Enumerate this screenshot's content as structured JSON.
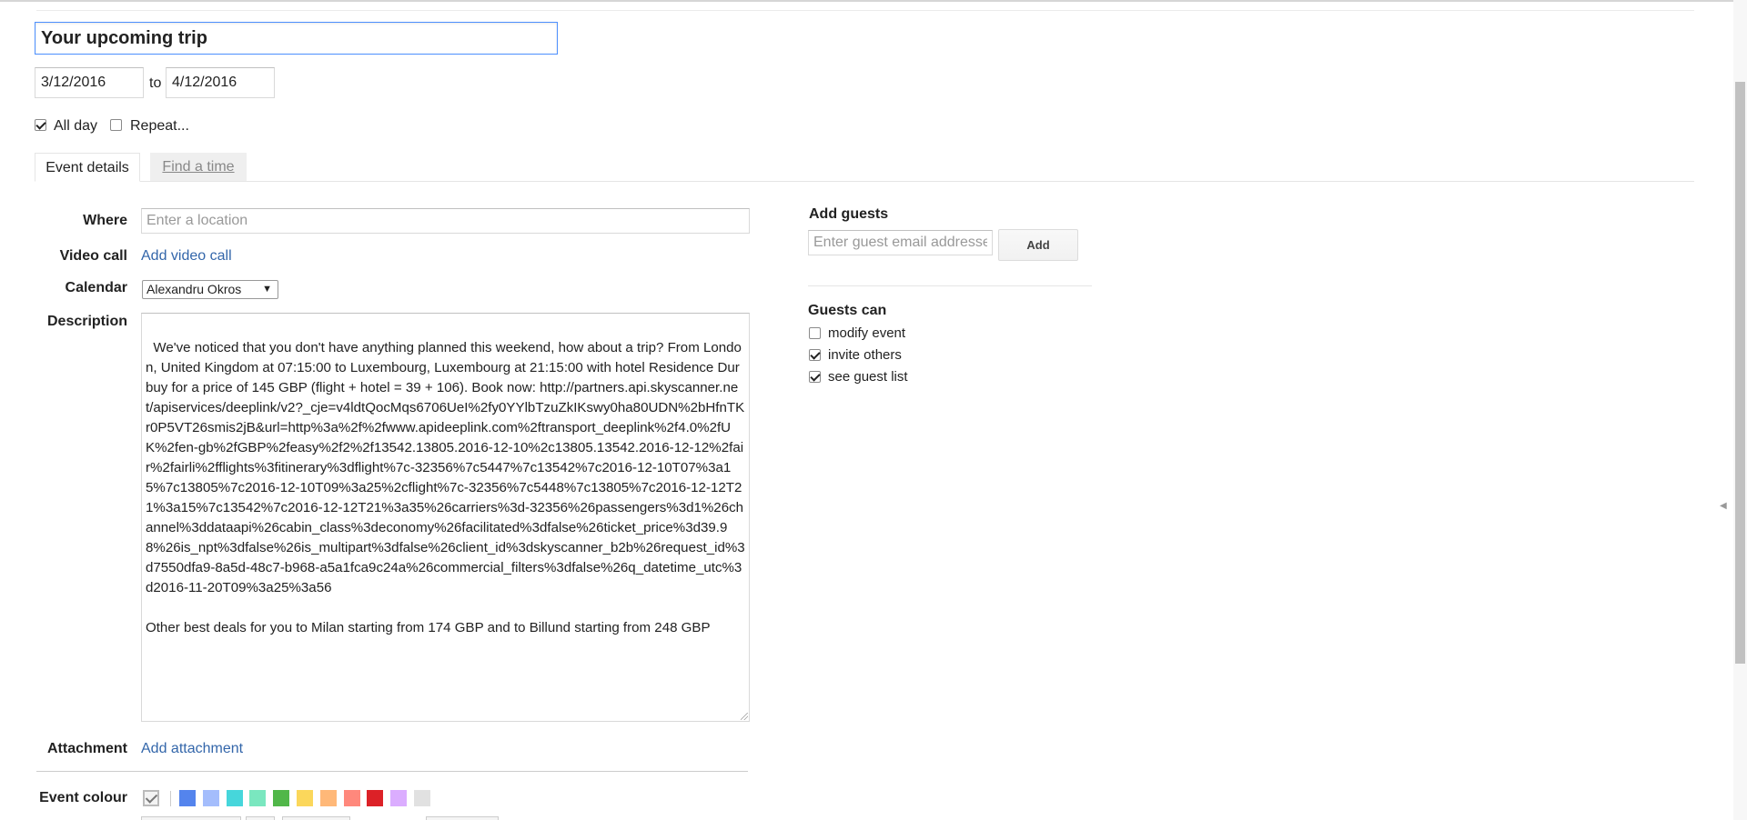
{
  "event": {
    "title": "Your upcoming trip",
    "start_date": "3/12/2016",
    "to_label": "to",
    "end_date": "4/12/2016",
    "all_day_label": "All day",
    "all_day_checked": true,
    "repeat_label": "Repeat...",
    "repeat_checked": false
  },
  "tabs": [
    {
      "label": "Event details",
      "active": true
    },
    {
      "label": "Find a time",
      "active": false
    }
  ],
  "details": {
    "where_label": "Where",
    "where_placeholder": "Enter a location",
    "video_label": "Video call",
    "video_link": "Add video call",
    "calendar_label": "Calendar",
    "calendar_value": "Alexandru Okros",
    "description_label": "Description",
    "description_text": "We've noticed that you don't have anything planned this weekend, how about a trip? From London, United Kingdom at 07:15:00 to Luxembourg, Luxembourg at 21:15:00 with hotel Residence Durbuy for a price of 145 GBP (flight + hotel = 39 + 106). Book now: http://partners.api.skyscanner.net/apiservices/deeplink/v2?_cje=v4ldtQocMqs6706UeI%2fy0YYlbTzuZkIKswy0ha80UDN%2bHfnTKr0P5VT26smis2jB&url=http%3a%2f%2fwww.apideeplink.com%2ftransport_deeplink%2f4.0%2fUK%2fen-gb%2fGBP%2feasy%2f2%2f13542.13805.2016-12-10%2c13805.13542.2016-12-12%2fair%2fairli%2fflights%3fitinerary%3dflight%7c-32356%7c5447%7c13542%7c2016-12-10T07%3a15%7c13805%7c2016-12-10T09%3a25%2cflight%7c-32356%7c5448%7c13805%7c2016-12-12T21%3a15%7c13542%7c2016-12-12T21%3a35%26carriers%3d-32356%26passengers%3d1%26channel%3ddataapi%26cabin_class%3deconomy%26facilitated%3dfalse%26ticket_price%3d39.98%26is_npt%3dfalse%26is_multipart%3dfalse%26client_id%3dskyscanner_b2b%26request_id%3d7550dfa9-8a5d-48c7-b968-a5a1fca9c24a%26commercial_filters%3dfalse%26q_datetime_utc%3d2016-11-20T09%3a25%3a56\n\nOther best deals for you to Milan starting from 174 GBP and to Billund starting from 248 GBP",
    "attachment_label": "Attachment",
    "attachment_link": "Add attachment",
    "colour_label": "Event colour",
    "colours": [
      "#5484ed",
      "#a4bdfc",
      "#46d6db",
      "#7ae7bf",
      "#51b749",
      "#fbd75b",
      "#ffb878",
      "#ff887c",
      "#dc2127",
      "#dbadff",
      "#e1e1e1"
    ]
  },
  "guests": {
    "add_title": "Add guests",
    "input_placeholder": "Enter guest email addresses",
    "add_button": "Add",
    "can_title": "Guests can",
    "permissions": [
      {
        "label": "modify event",
        "checked": false
      },
      {
        "label": "invite others",
        "checked": true
      },
      {
        "label": "see guest list",
        "checked": true
      }
    ]
  }
}
